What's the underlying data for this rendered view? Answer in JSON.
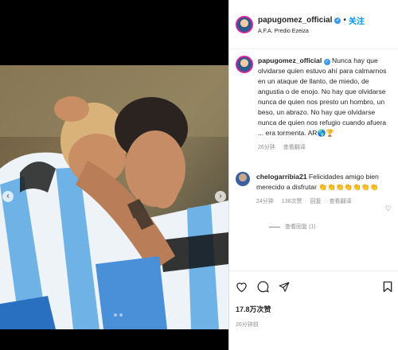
{
  "post": {
    "username": "papugomez_official",
    "follow_label": "关注",
    "separator": "•",
    "location": "A.F.A. Predio Ezeiza"
  },
  "caption": {
    "username": "papugomez_official",
    "text": "Nunca hay que olvidarse quien estuvo ahí para calmarnos en un ataque de llanto, de miedo, de angustia o de enojo. No hay que olvidarse nunca de quien nos presto un hombro, un beso, un abrazo. No hay que olvidarse nunca de quien nos refugio cuando afuera ... era tormenta. AR🌎🏆",
    "age": "26分钟",
    "translate": "查看翻译"
  },
  "comment": {
    "username": "chelogarribia21",
    "text": "Felicidades amigo bien merecido a disfrutar 👏👏👏👏👏👏👏",
    "age": "24分钟",
    "likes": "138次赞",
    "reply": "回复",
    "translate": "查看翻译",
    "replies": "查看回复 (1)"
  },
  "likes_count": "17.8万次赞",
  "timestamp": "26分钟前",
  "colors": {
    "accent": "#0095f6",
    "verified": "#3897f0"
  }
}
